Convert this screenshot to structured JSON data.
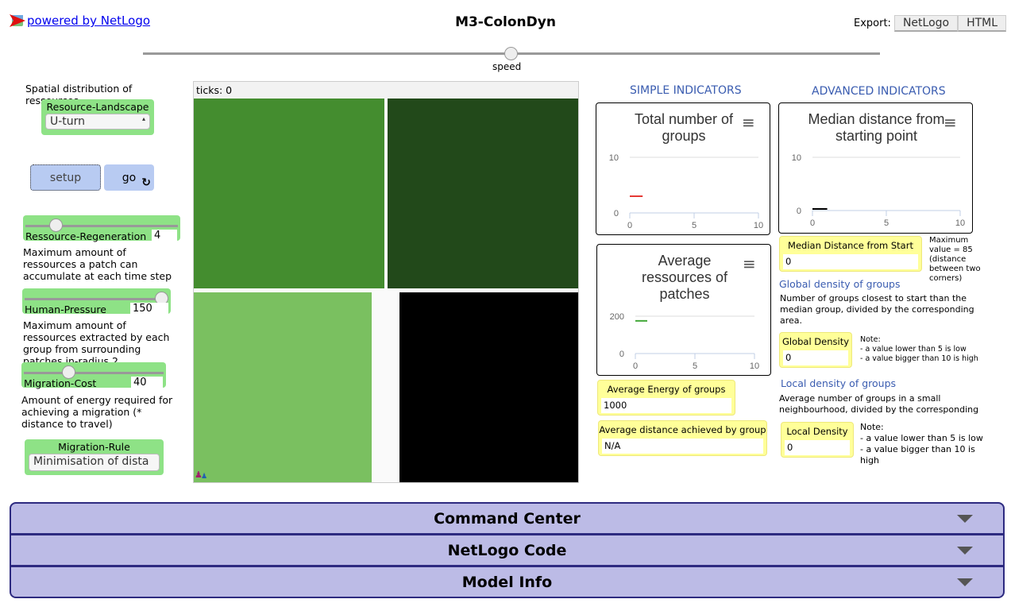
{
  "header": {
    "brand": "powered by NetLogo",
    "title": "M3-ColonDyn",
    "export_label": "Export:",
    "export_netlogo": "NetLogo",
    "export_html": "HTML",
    "speed_label": "speed",
    "speed_value": 0.5
  },
  "left": {
    "landscape_note": "Spatial distribution of ressources",
    "landscape_label": "Resource-Landscape",
    "landscape_value": "U-turn",
    "setup": "setup",
    "go": "go",
    "regen_label": "Ressource-Regeneration",
    "regen_value": "4",
    "regen_fraction": 0.17,
    "regen_note": "Maximum amount of ressources a patch can accumulate at each time step",
    "pressure_label": "Human-Pressure",
    "pressure_value": "150",
    "pressure_fraction": 1.0,
    "pressure_note": "Maximum amount of ressources extracted by each group from surrounding patches in-radius 2",
    "migcost_label": "Migration-Cost",
    "migcost_value": "40",
    "migcost_fraction": 0.3,
    "migcost_note": "Amount of energy required for achieving a migration (* distance to travel)",
    "rule_label": "Migration-Rule",
    "rule_value": "Minimisation of dista"
  },
  "view": {
    "ticks": "ticks: 0",
    "colors": {
      "tl": "#448d2f",
      "tr": "#22491a",
      "bl": "#7ac060",
      "br": "#000000"
    }
  },
  "right": {
    "simple_header": "SIMPLE INDICATORS",
    "advanced_header": "ADVANCED INDICATORS",
    "avg_energy_label": "Average Energy of groups",
    "avg_energy_value": "1000",
    "avg_dist_label": "Average distance achieved by group",
    "avg_dist_value": "N/A",
    "median_label": "Median Distance from Start",
    "median_value": "0",
    "median_note": "Maximum value = 85 (distance between two corners)",
    "global_header": "Global density of groups",
    "global_desc": "Number of groups closest to start than the median group, divided by the corresponding area.",
    "global_label": "Global Density",
    "global_value": "0",
    "global_note": [
      "Note:",
      "- a value lower than 5 is low",
      "- a value bigger than 10 is high"
    ],
    "local_header": "Local density of groups",
    "local_desc": "Average number of groups in a small neighbourhood, divided by the corresponding",
    "local_label": "Local Density",
    "local_value": "0",
    "local_note": [
      "Note:",
      "- a value lower than 5 is low",
      "- a value bigger than 10 is high"
    ]
  },
  "chart_data": [
    {
      "type": "line",
      "title": "Total number of groups",
      "xlim": [
        0,
        10
      ],
      "ylim": [
        0,
        10
      ],
      "xticks": [
        "0",
        "5",
        "10"
      ],
      "yticks": [
        "0",
        "10"
      ],
      "series": [
        {
          "color": "#e53935",
          "x": [
            0,
            1
          ],
          "y": [
            3,
            3
          ]
        }
      ]
    },
    {
      "type": "line",
      "title": "Median distance from starting point",
      "xlim": [
        0,
        10
      ],
      "ylim": [
        0,
        10
      ],
      "xticks": [
        "0",
        "5",
        "10"
      ],
      "yticks": [
        "0",
        "10"
      ],
      "series": [
        {
          "color": "#000000",
          "x": [
            0,
            1
          ],
          "y": [
            0,
            0
          ]
        }
      ]
    },
    {
      "type": "line",
      "title": "Average ressources of patches",
      "xlim": [
        0,
        10
      ],
      "ylim": [
        0,
        200
      ],
      "xticks": [
        "0",
        "5",
        "10"
      ],
      "yticks": [
        "0",
        "200"
      ],
      "series": [
        {
          "color": "#43a83a",
          "x": [
            0,
            1
          ],
          "y": [
            175,
            175
          ]
        }
      ]
    }
  ],
  "tabs": [
    "Command Center",
    "NetLogo Code",
    "Model Info"
  ]
}
